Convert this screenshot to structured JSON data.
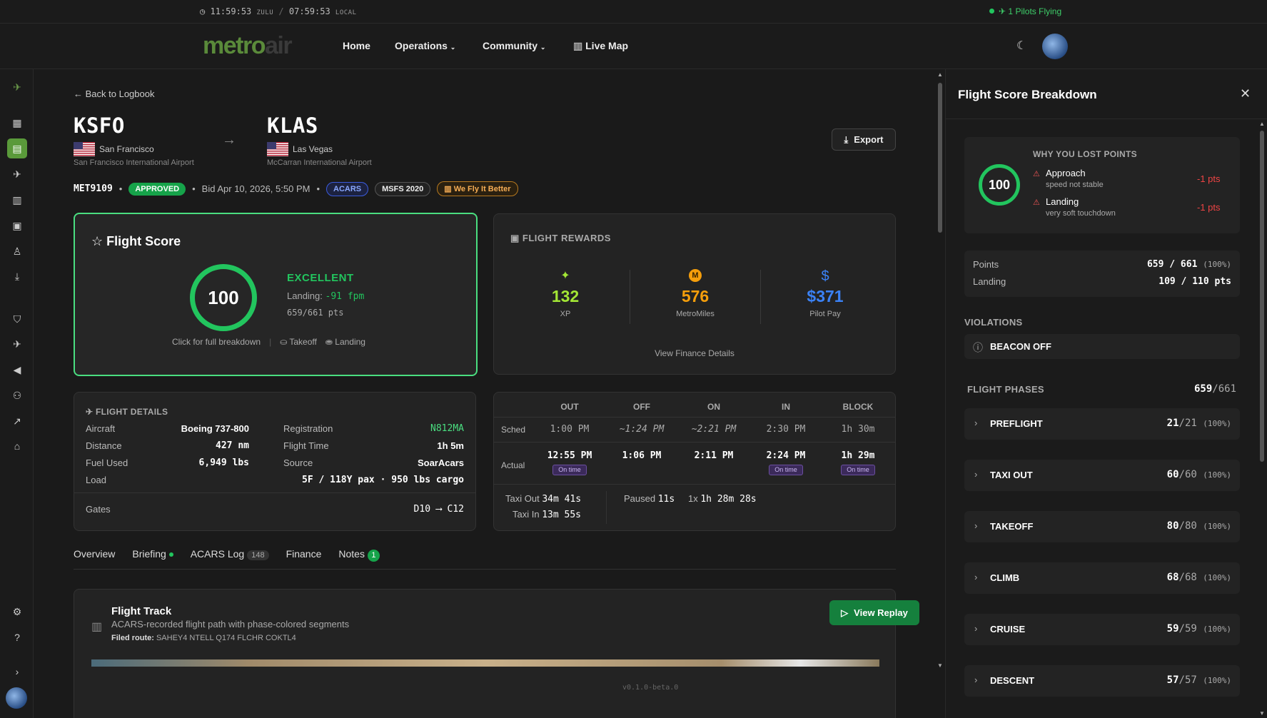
{
  "clock": {
    "zulu": "11:59:53",
    "zulu_label": "ZULU",
    "sep": "/",
    "local": "07:59:53",
    "local_label": "LOCAL"
  },
  "pilots_flying": {
    "count": "1",
    "label": "Pilots Flying"
  },
  "nav": {
    "logo_a": "metro",
    "logo_b": "air",
    "home": "Home",
    "operations": "Operations",
    "community": "Community",
    "live_map": "Live Map"
  },
  "back_label": "Back to Logbook",
  "origin": {
    "code": "KSFO",
    "city": "San Francisco",
    "airport": "San Francisco International Airport"
  },
  "destination": {
    "code": "KLAS",
    "city": "Las Vegas",
    "airport": "McCarran International Airport"
  },
  "export_label": "Export",
  "flight_meta": {
    "flight_number": "MET9109",
    "status": "APPROVED",
    "bid": "Bid Apr 10, 2026, 5:50 PM",
    "badges": [
      "ACARS",
      "MSFS 2020",
      "We Fly It Better"
    ]
  },
  "score": {
    "title": "Flight Score",
    "value": "100",
    "rating": "EXCELLENT",
    "landing_label": "Landing:",
    "landing_value": "-91 fpm",
    "points": "659/661 pts",
    "breakdown_link": "Click for full breakdown",
    "takeoff_link": "Takeoff",
    "landing_link": "Landing"
  },
  "rewards": {
    "title": "FLIGHT REWARDS",
    "items": [
      {
        "value": "132",
        "label": "XP",
        "color": "#a3e635"
      },
      {
        "value": "576",
        "label": "MetroMiles",
        "color": "#f59e0b"
      },
      {
        "value": "$371",
        "label": "Pilot Pay",
        "color": "#3b82f6"
      }
    ],
    "finance_link": "View Finance Details"
  },
  "details": {
    "title": "FLIGHT DETAILS",
    "aircraft_l": "Aircraft",
    "aircraft": "Boeing 737-800",
    "registration_l": "Registration",
    "registration": "N812MA",
    "distance_l": "Distance",
    "distance": "427 nm",
    "flight_time_l": "Flight Time",
    "flight_time": "1h 5m",
    "fuel_l": "Fuel Used",
    "fuel": "6,949 lbs",
    "source_l": "Source",
    "source": "SoarAcars",
    "load_l": "Load",
    "load": "5F / 118Y pax · 950 lbs cargo",
    "gates_l": "Gates",
    "gates": "D10 ⟶ C12"
  },
  "times": {
    "headers": [
      "OUT",
      "OFF",
      "ON",
      "IN",
      "BLOCK"
    ],
    "sched_label": "Sched",
    "sched": [
      "1:00 PM",
      "~1:24 PM",
      "~2:21 PM",
      "2:30 PM",
      "1h 30m"
    ],
    "actual_label": "Actual",
    "actual": [
      "12:55 PM",
      "1:06 PM",
      "2:11 PM",
      "2:24 PM",
      "1h 29m"
    ],
    "on_time": "On time",
    "taxi_out_l": "Taxi Out",
    "taxi_out": "34m 41s",
    "taxi_in_l": "Taxi In",
    "taxi_in": "13m 55s",
    "paused_l": "Paused",
    "paused": "11s",
    "rate": "1x",
    "rate_time": "1h 28m 28s"
  },
  "tabs": {
    "overview": "Overview",
    "briefing": "Briefing",
    "acars": "ACARS Log",
    "acars_count": "148",
    "finance": "Finance",
    "notes": "Notes",
    "notes_count": "1"
  },
  "track": {
    "title": "Flight Track",
    "subtitle": "ACARS-recorded flight path with phase-colored segments",
    "route_label": "Filed route:",
    "route": "SAHEY4 NTELL Q174 FLCHR COKTL4",
    "replay": "View Replay"
  },
  "version": "v0.1.0-beta.0",
  "panel": {
    "title": "Flight Score Breakdown",
    "why_title": "WHY YOU LOST POINTS",
    "score": "100",
    "losses": [
      {
        "name": "Approach",
        "desc": "speed not stable",
        "pts": "-1 pts"
      },
      {
        "name": "Landing",
        "desc": "very soft touchdown",
        "pts": "-1 pts"
      }
    ],
    "points_l": "Points",
    "points": "659 / 661",
    "points_pct": "(100%)",
    "landing_l": "Landing",
    "landing": "109 / 110 pts",
    "violations_title": "VIOLATIONS",
    "violation": "BEACON OFF",
    "phases_title": "FLIGHT PHASES",
    "phases_score": "659",
    "phases_max": "/661",
    "phases": [
      {
        "name": "PREFLIGHT",
        "score": "21",
        "max": "/21",
        "pct": "(100%)"
      },
      {
        "name": "TAXI OUT",
        "score": "60",
        "max": "/60",
        "pct": "(100%)"
      },
      {
        "name": "TAKEOFF",
        "score": "80",
        "max": "/80",
        "pct": "(100%)"
      },
      {
        "name": "CLIMB",
        "score": "68",
        "max": "/68",
        "pct": "(100%)"
      },
      {
        "name": "CRUISE",
        "score": "59",
        "max": "/59",
        "pct": "(100%)"
      },
      {
        "name": "DESCENT",
        "score": "57",
        "max": "/57",
        "pct": "(100%)"
      }
    ]
  }
}
